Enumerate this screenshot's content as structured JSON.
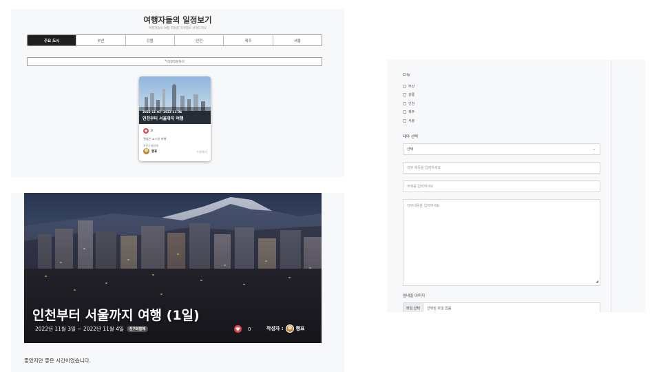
{
  "list_page": {
    "title": "여행자들의 일정보기",
    "subtitle": "여행자들의 여행 리뷰를 지역별로 보여드려요",
    "tabs": [
      "주요 도시",
      "부산",
      "강릉",
      "인천",
      "제주",
      "서울"
    ],
    "active_tab": "주요 도시",
    "write_button": "리뷰작성하기",
    "card": {
      "dates": "2022-11-03~2022-11-04",
      "title": "인천부터 서울까지 여행",
      "likes": "0",
      "description": "괜찮은 코스인 여행",
      "tag": "#친구와함께",
      "author": "짱표",
      "edit_label": "수정하기"
    }
  },
  "detail_page": {
    "title": "인천부터 서울까지 여행 (1일)",
    "dates": "2022년 11월 3일 ~ 2022년 11월 4일",
    "badge": "친구와함께",
    "likes": "0",
    "author_label": "작성자 :",
    "author": "짱표",
    "body": "좋았지만 좋은 시간이었습니다."
  },
  "form_page": {
    "city_label": "City",
    "cities": [
      "부산",
      "강릉",
      "인천",
      "제주",
      "서울"
    ],
    "theme_label": "테마 선택",
    "theme_value": "선택",
    "review_title_placeholder": "리뷰 제목을 입력하세요",
    "subtitle_placeholder": "부제를 입력하세요",
    "content_placeholder": "리뷰내용을 입력하세요",
    "image_label": "썸네일 이미지",
    "file_button": "파일 선택",
    "file_status": "선택된 파일 없음"
  },
  "colors": {
    "active_tab_bg": "#1f1f1f",
    "like_heart": "#e0474c",
    "page_bg": "#f7f8fa"
  },
  "icons": [
    "heart-icon",
    "pencil-icon",
    "chevron-down-icon",
    "avatar"
  ]
}
